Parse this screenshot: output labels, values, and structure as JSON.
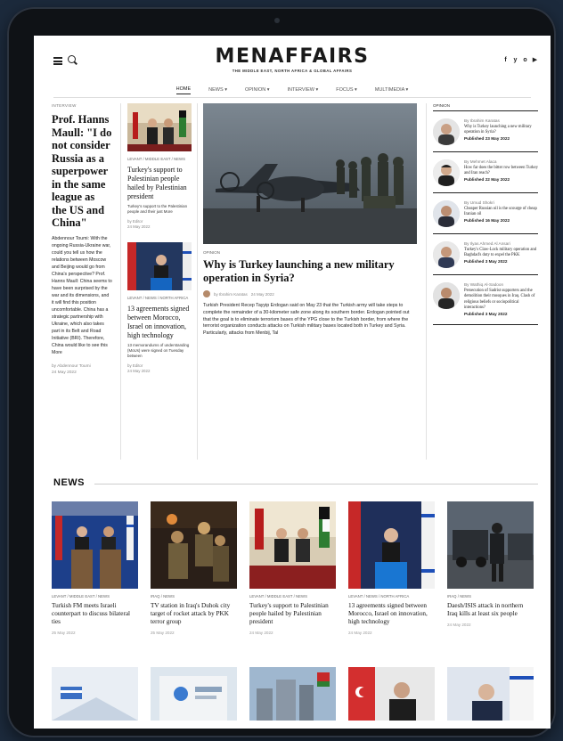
{
  "site": {
    "logo": "MENAFFAIRS",
    "tagline": "THE MIDDLE EAST, NORTH AFRICA & GLOBAL AFFAIRS",
    "socials": [
      "f",
      "y",
      "o",
      "▶"
    ]
  },
  "nav": {
    "items": [
      "HOME",
      "NEWS",
      "OPINION",
      "INTERVIEW",
      "FOCUS",
      "MULTIMEDIA"
    ],
    "active": "HOME"
  },
  "interview": {
    "section": "INTERVIEW",
    "title": "Prof. Hanns Maull: \"I do not consider Russia as a superpower in the same league as the US and China\"",
    "body": "Abdennour Toumi: With the ongoing Russia-Ukraine war, could you tell us how the relations between Moscow and Beijing would go from China's perspective? Prof. Hanns Maull: China seems to have been surprised by the war and its dimensions, and it will find this position uncomfortable. China has a strategic partnership with Ukraine, which also takes part in its Belt and Road Initiative (BRI). Therefore, China would like to see this",
    "more": "More",
    "author": "by Abdennour Toumi",
    "date": "24 May 2022"
  },
  "middle": [
    {
      "tag": "LEVANT / MIDDLE EAST / NEWS",
      "title": "Turkey's support to Palestinian people hailed by Palestinian president",
      "desc": "Turkey's support to the Palestinian people and their just",
      "more": "More",
      "author": "by Editor",
      "date": "24 May 2022"
    },
    {
      "tag": "LEVANT / NEWS / NORTH AFRICA",
      "title": "13 agreements signed between Morocco, Israel on innovation, high technology",
      "desc": "13 memorandums of understanding (MoUs) were signed on Tuesday between",
      "more": "More",
      "author": "by Editor",
      "date": "24 May 2022"
    }
  ],
  "featured": {
    "tag": "OPINION",
    "title": "Why is Turkey launching a new military operation in Syria?",
    "author": "by Ibrahim Karatas",
    "date": "24 May 2022",
    "body": "Turkish President Recep Tayyip Erdogan said on May 23 that the Turkish army will take steps to complete the remainder of a 30-kilometer safe zone along its southern border. Erdogan pointed out that the goal is to eliminate terrorism bases of the YPG close to the Turkish border, from where the terrorist organization conducts attacks on Turkish military bases located both in Turkey and Syria. Particularly, attacks from Menbij, Tal"
  },
  "opinion": {
    "section": "OPINION",
    "items": [
      {
        "author": "By Ibrahim Karatas",
        "title": "Why is Turkey launching a new military operation in Syria?",
        "date": "Published 23 May 2022"
      },
      {
        "author": "By Mehmet Alaca",
        "title": "How far does the bitter row between Turkey and Iran reach?",
        "date": "Published 22 May 2022"
      },
      {
        "author": "By Umud Shokri",
        "title": "Cheaper Russian oil is the scourge of cheap Iranian oil",
        "date": "Published 16 May 2022"
      },
      {
        "author": "By Ilyas Ahmed Al Ansari",
        "title": "Turkey's Claw-Lock military operation and Baghdad's duty to expel the PKK",
        "date": "Published 3 May 2022"
      },
      {
        "author": "By Wathiq Al-Sadoon",
        "title": "Persecution of Sadrist supporters and the demolition their mosques in Iraq. Clash of religious beliefs or sociopolitical interactions?",
        "date": "Published 3 May 2022"
      }
    ]
  },
  "news": {
    "heading": "NEWS",
    "items": [
      {
        "tag": "LEVANT / MIDDLE EAST / NEWS",
        "title": "Turkish FM meets Israeli counterpart to discuss bilateral ties",
        "date": "25 May 2022"
      },
      {
        "tag": "IRAQ / NEWS",
        "title": "TV station in Iraq's Duhok city target of rocket attack by PKK terror group",
        "date": "25 May 2022"
      },
      {
        "tag": "LEVANT / MIDDLE EAST / NEWS",
        "title": "Turkey's support to Palestinian people hailed by Palestinian president",
        "date": "24 May 2022"
      },
      {
        "tag": "LEVANT / NEWS / NORTH AFRICA",
        "title": "13 agreements signed between Morocco, Israel on innovation, high technology",
        "date": "24 May 2022"
      },
      {
        "tag": "IRAQ / NEWS",
        "title": "Daesh/ISIS attack in northern Iraq kills at least six people",
        "date": "24 May 2022"
      }
    ]
  }
}
